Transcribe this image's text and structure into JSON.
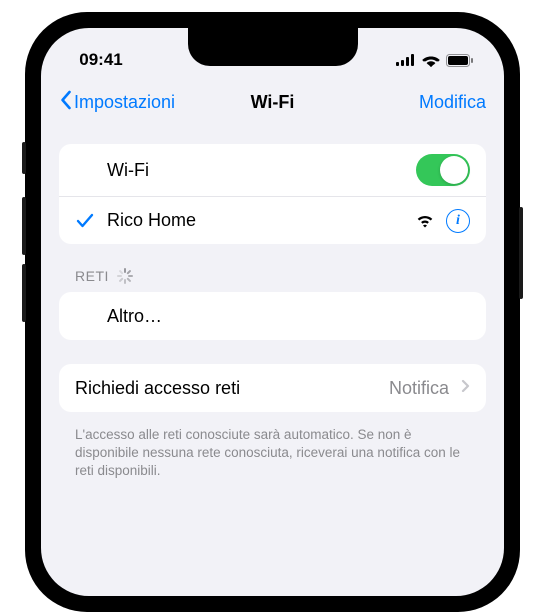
{
  "status": {
    "time": "09:41"
  },
  "nav": {
    "back": "Impostazioni",
    "title": "Wi-Fi",
    "action": "Modifica"
  },
  "wifi": {
    "label": "Wi-Fi",
    "connected": {
      "name": "Rico Home"
    }
  },
  "sections": {
    "networks": {
      "header": "Reti",
      "other": "Altro…"
    },
    "ask": {
      "label": "Richiedi accesso reti",
      "value": "Notifica",
      "footer": "L'accesso alle reti conosciute sarà automatico. Se non è disponibile nessuna rete conosciuta, riceverai una notifica con le reti disponibili."
    }
  }
}
